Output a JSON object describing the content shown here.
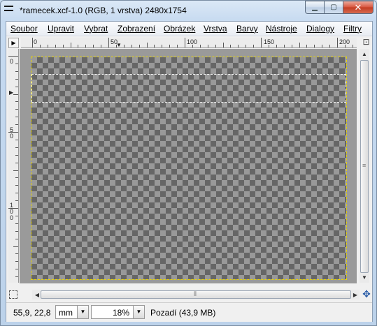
{
  "window": {
    "title": "*ramecek.xcf-1.0 (RGB, 1 vrstva) 2480x1754",
    "minimize_label": "▁",
    "maximize_label": "▢",
    "close_label": "✕"
  },
  "menubar": {
    "items": [
      {
        "label": "Soubor"
      },
      {
        "label": "Upravit"
      },
      {
        "label": "Vybrat"
      },
      {
        "label": "Zobrazení"
      },
      {
        "label": "Obrázek"
      },
      {
        "label": "Vrstva"
      },
      {
        "label": "Barvy"
      },
      {
        "label": "Nástroje"
      },
      {
        "label": "Dialogy"
      },
      {
        "label": "Filtry"
      }
    ]
  },
  "rulers": {
    "horizontal_labels": [
      "0",
      "50",
      "100",
      "150",
      "200"
    ],
    "vertical_labels": [
      "0",
      "5 0",
      "1 0 0"
    ]
  },
  "statusbar": {
    "coordinates": "55,9, 22,8",
    "unit": "mm",
    "zoom": "18%",
    "status": "Pozadí (43,9 MB)"
  },
  "icons": {
    "menu_toggle": "triangle-right-icon",
    "nav_toggle": "zoom-fit-icon",
    "quick_mask": "quick-mask-icon",
    "navigate": "navigate-cross-icon"
  }
}
